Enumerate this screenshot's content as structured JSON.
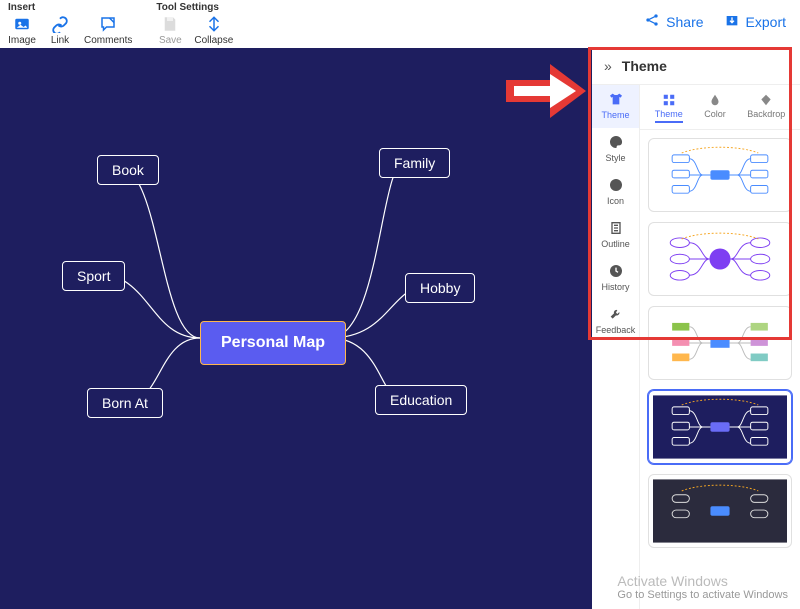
{
  "toolbar": {
    "insert_group": "Insert",
    "tool_group": "Tool Settings",
    "image": "Image",
    "link": "Link",
    "comments": "Comments",
    "save": "Save",
    "collapse": "Collapse",
    "share": "Share",
    "export": "Export"
  },
  "mindmap": {
    "center": "Personal Map",
    "book": "Book",
    "sport": "Sport",
    "born": "Born At",
    "family": "Family",
    "hobby": "Hobby",
    "education": "Education"
  },
  "panel": {
    "title": "Theme",
    "vtabs": {
      "theme": "Theme",
      "style": "Style",
      "icon": "Icon",
      "outline": "Outline",
      "history": "History",
      "feedback": "Feedback"
    },
    "subtabs": {
      "theme": "Theme",
      "color": "Color",
      "backdrop": "Backdrop"
    }
  },
  "watermark": {
    "l1": "Activate Windows",
    "l2": "Go to Settings to activate Windows"
  }
}
